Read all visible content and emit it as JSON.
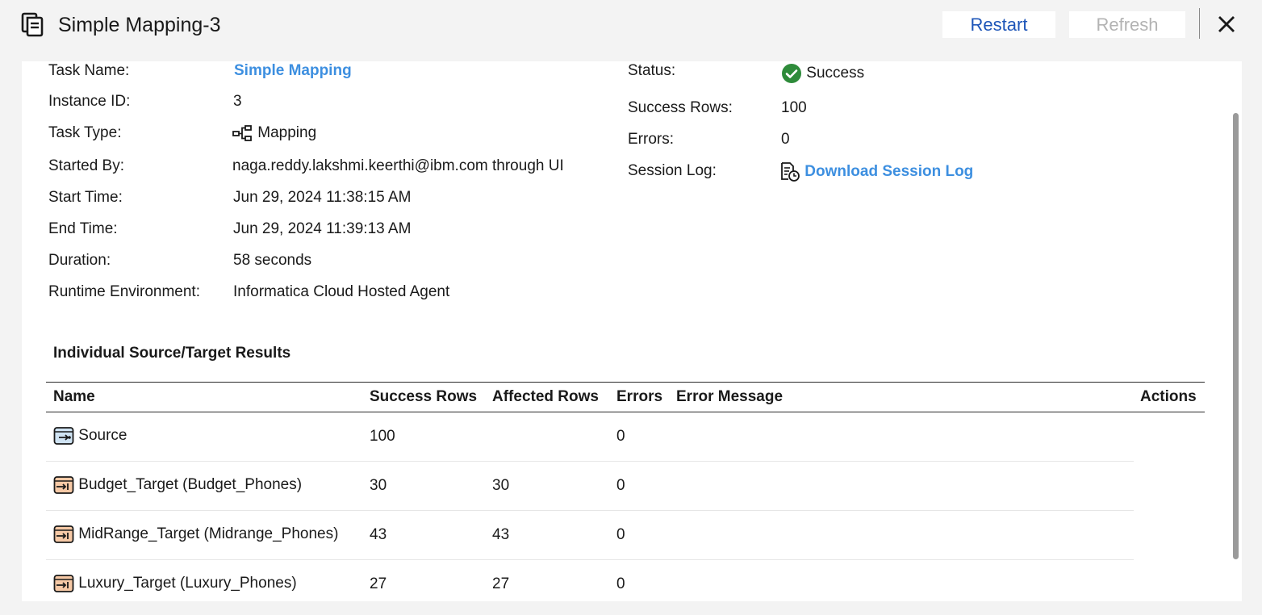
{
  "header": {
    "title": "Simple Mapping-3",
    "restart_label": "Restart",
    "refresh_label": "Refresh"
  },
  "details_left": [
    {
      "label": "Task Name:",
      "value": "Simple Mapping"
    },
    {
      "label": "Instance ID:",
      "value": "3"
    },
    {
      "label": "Task Type:",
      "value": "Mapping"
    },
    {
      "label": "Started By:",
      "value": "naga.reddy.lakshmi.keerthi@ibm.com through UI"
    },
    {
      "label": "Start Time:",
      "value": "Jun 29, 2024 11:38:15 AM"
    },
    {
      "label": "End Time:",
      "value": "Jun 29, 2024 11:39:13 AM"
    },
    {
      "label": "Duration:",
      "value": "58 seconds"
    },
    {
      "label": "Runtime Environment:",
      "value": "Informatica Cloud Hosted Agent"
    }
  ],
  "details_right": [
    {
      "label": "Status:",
      "value": "Success"
    },
    {
      "label": "Success Rows:",
      "value": "100"
    },
    {
      "label": "Errors:",
      "value": "0"
    },
    {
      "label": "Session Log:",
      "value": "Download Session Log"
    }
  ],
  "results": {
    "title": "Individual Source/Target Results",
    "columns": [
      "Name",
      "Success Rows",
      "Affected Rows",
      "Errors",
      "Error Message",
      "Actions"
    ],
    "rows": [
      {
        "name": "Source",
        "success_rows": "100",
        "affected_rows": "",
        "errors": "0",
        "error_message": "",
        "icon": "source-icon"
      },
      {
        "name": "Budget_Target (Budget_Phones)",
        "success_rows": "30",
        "affected_rows": "30",
        "errors": "0",
        "error_message": "",
        "icon": "target-icon"
      },
      {
        "name": "MidRange_Target (Midrange_Phones)",
        "success_rows": "43",
        "affected_rows": "43",
        "errors": "0",
        "error_message": "",
        "icon": "target-icon"
      },
      {
        "name": "Luxury_Target (Luxury_Phones)",
        "success_rows": "27",
        "affected_rows": "27",
        "errors": "0",
        "error_message": "",
        "icon": "target-icon"
      }
    ]
  },
  "colors": {
    "link": "#3d8fe0",
    "restart": "#1d55b8",
    "refresh_disabled": "#b3b3b3",
    "success_green": "#2e8b3a"
  }
}
